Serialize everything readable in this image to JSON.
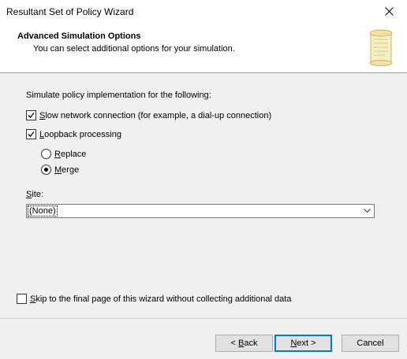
{
  "window": {
    "title": "Resultant Set of Policy Wizard"
  },
  "header": {
    "title": "Advanced Simulation Options",
    "subtitle": "You can select additional options for your simulation."
  },
  "options": {
    "intro": "Simulate policy implementation for the following:",
    "slow_network": {
      "accel": "S",
      "rest": "low network connection (for example, a dial-up connection)",
      "checked": true
    },
    "loopback": {
      "accel": "L",
      "rest": "oopback processing",
      "checked": true
    },
    "replace": {
      "accel": "R",
      "rest": "eplace",
      "selected": false
    },
    "merge": {
      "accel": "M",
      "rest": "erge",
      "selected": true
    }
  },
  "site": {
    "label_accel": "S",
    "label_rest": "ite:",
    "value": "(None)"
  },
  "skip": {
    "accel": "S",
    "rest": "kip to the final page of this wizard without collecting additional data",
    "checked": false
  },
  "buttons": {
    "back_prefix": "< ",
    "back_accel": "B",
    "back_rest": "ack",
    "next_accel": "N",
    "next_rest": "ext >",
    "cancel": "Cancel"
  },
  "icons": {
    "close": "close-icon",
    "header": "scroll-icon",
    "check": "check-icon",
    "dropdown": "chevron-down-icon"
  }
}
